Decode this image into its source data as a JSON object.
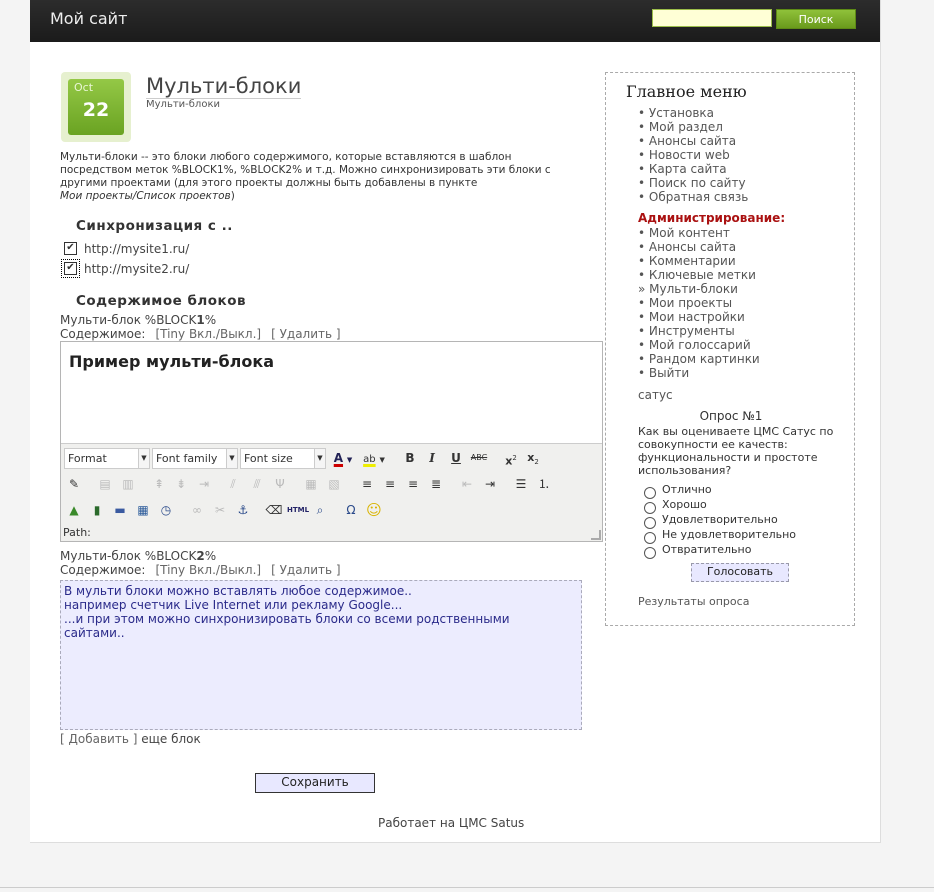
{
  "header": {
    "site_title": "Мой сайт",
    "search_placeholder": "",
    "search_button": "Поиск"
  },
  "post": {
    "date_month": "Oct",
    "date_day": "22",
    "title": "Мульти-блоки",
    "subtitle": "Мульти-блоки",
    "intro": "Мульти-блоки -- это блоки любого содержимого, которые вставляются в шаблон посредством меток %BLOCK1%, %BLOCK2% и т.д. Можно синхронизировать эти блоки с другими проектами (для этого проекты должны быть добавлены в пункте",
    "intro_link": "Мои проекты/Список проектов",
    "intro_tail": ")"
  },
  "sync": {
    "heading": "Синхронизация с ..",
    "sites": [
      {
        "label": "http://mysite1.ru/",
        "checked": true
      },
      {
        "label": "http://mysite2.ru/",
        "checked": true
      }
    ]
  },
  "blocks": {
    "heading": "Содержимое блоков",
    "block1": {
      "label_prefix": "Мульти-блок %BLOCK",
      "label_num": "1",
      "label_suffix": "%",
      "content_label": "Содержимое:",
      "tiny_toggle": "[Tiny Вкл./Выкл.]",
      "delete": "[ Удалить ]",
      "heading_text": "Пример мульти-блока"
    },
    "block2": {
      "label_prefix": "Мульти-блок %BLOCK",
      "label_num": "2",
      "label_suffix": "%",
      "content_label": "Содержимое:",
      "tiny_toggle": "[Tiny Вкл./Выкл.]",
      "delete": "[ Удалить ]",
      "lines": [
        "В мульти блоки можно вставлять любое содержимое..",
        "например счетчик Live Internet  или рекламу Google...",
        "...и при этом можно синхронизировать блоки со всеми родственными",
        "сайтами.."
      ]
    },
    "add_link": "[ Добавить ]",
    "add_tail": " еще блок",
    "save_button": "Сохранить"
  },
  "editor_toolbar": {
    "format": "Format",
    "font_family": "Font family",
    "font_size": "Font size",
    "path_label": "Path:"
  },
  "footer": "Работает на ЦМС Satus",
  "sidebar": {
    "menu_title": "Главное меню",
    "main_items": [
      "• Установка",
      "• Мой раздел",
      "• Анонсы сайта",
      "• Новости web",
      "• Карта сайта",
      "• Поиск по сайту",
      "• Обратная связь"
    ],
    "admin_title": "Администрирование:",
    "admin_items": [
      "• Мой контент",
      "• Анонсы сайта",
      "• Комментарии",
      "• Ключевые метки",
      "» Мульти-блоки",
      "• Мои проекты",
      "• Мои настройки",
      "• Инструменты",
      "• Мой голоссарий",
      "• Рандом картинки",
      "• Выйти"
    ],
    "satus": "сатус",
    "poll_title": "Опрос №1",
    "poll_question": "Как вы оцениваете ЦМС Сатус по совокупности ее качеств: функциональности и простоте использования?",
    "poll_options": [
      "Отлично",
      "Хорошо",
      "Удовлетворительно",
      "Не удовлетворительно",
      "Отвратительно"
    ],
    "vote_button": "Голосовать",
    "poll_results": "Результаты опроса"
  },
  "colors": {
    "accent_green": "#7aae2a",
    "admin_red": "#aa1111",
    "editor_bg": "#ececfe"
  }
}
